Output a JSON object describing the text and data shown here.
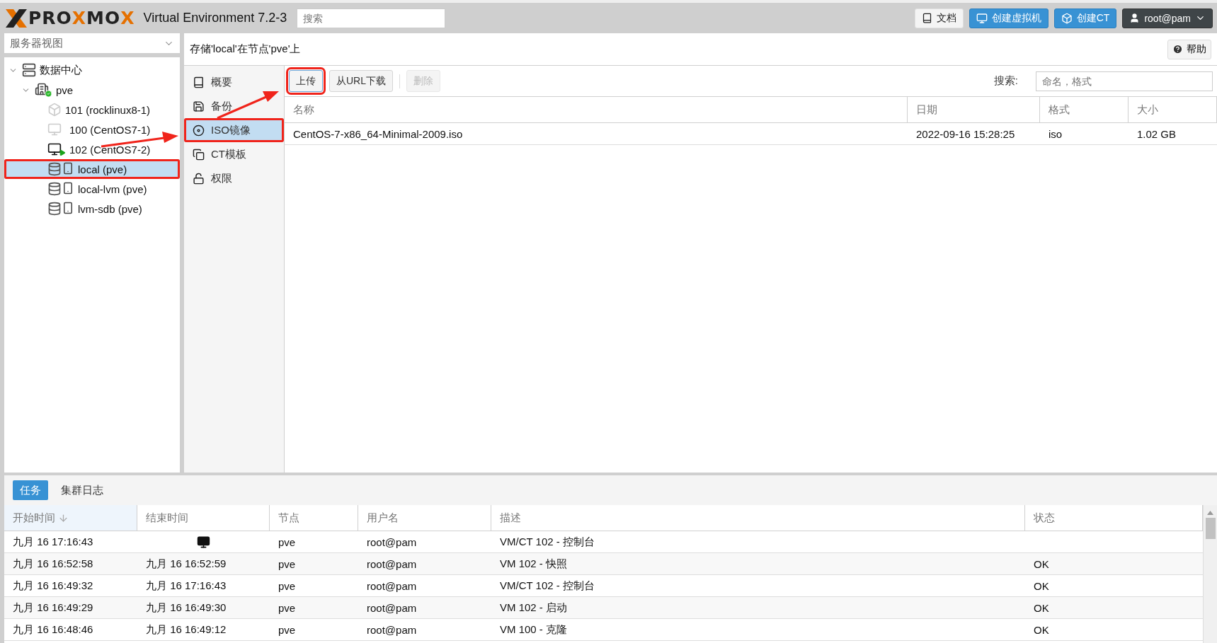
{
  "header": {
    "logo": [
      {
        "text": "PRO",
        "accent": false
      },
      {
        "text": "X",
        "accent": true
      },
      {
        "text": "MO",
        "accent": false
      },
      {
        "text": "X",
        "accent": true
      }
    ],
    "product": "Virtual Environment 7.2-3",
    "search_placeholder": "搜索",
    "buttons": [
      {
        "label": "文档",
        "kind": "docs"
      },
      {
        "label": "创建虚拟机",
        "kind": "vm"
      },
      {
        "label": "创建CT",
        "kind": "ct"
      }
    ],
    "user": "root@pam"
  },
  "sidebar": {
    "view": "服务器视图",
    "tree": [
      {
        "label": "数据中心",
        "kind": "datacenter",
        "expanded": true,
        "selected": false,
        "children": [
          {
            "label": "pve",
            "kind": "node",
            "expanded": true,
            "selected": false,
            "children": [
              {
                "label": "101 (rocklinux8-1)",
                "kind": "ct",
                "running": false,
                "selected": false
              },
              {
                "label": "100 (CentOS7-1)",
                "kind": "vm",
                "running": false,
                "selected": false
              },
              {
                "label": "102 (CentOS7-2)",
                "kind": "vm",
                "running": true,
                "selected": false
              },
              {
                "label": "local (pve)",
                "kind": "storage",
                "selected": true,
                "annotated": true
              },
              {
                "label": "local-lvm (pve)",
                "kind": "storage",
                "selected": false
              },
              {
                "label": "lvm-sdb (pve)",
                "kind": "storage",
                "selected": false
              }
            ]
          }
        ]
      }
    ]
  },
  "content": {
    "title": "存储'local'在节点'pve'上",
    "help": "帮助",
    "nav": [
      {
        "label": "概要",
        "kind": "summary",
        "selected": false
      },
      {
        "label": "备份",
        "kind": "backup",
        "selected": false
      },
      {
        "label": "ISO镜像",
        "kind": "iso",
        "selected": true,
        "annotated": true
      },
      {
        "label": "CT模板",
        "kind": "template",
        "selected": false
      },
      {
        "label": "权限",
        "kind": "permissions",
        "selected": false
      }
    ],
    "toolbar": {
      "buttons": [
        {
          "label": "上传",
          "disabled": false,
          "annotated": true
        },
        {
          "label": "从URL下载",
          "disabled": false,
          "annotated": false
        },
        {
          "label": "删除",
          "disabled": true,
          "annotated": false
        }
      ],
      "search_label": "搜索:",
      "search_placeholder": "命名，格式"
    },
    "table": {
      "columns": [
        "名称",
        "日期",
        "格式",
        "大小"
      ],
      "rows": [
        [
          "CentOS-7-x86_64-Minimal-2009.iso",
          "2022-09-16 15:28:25",
          "iso",
          "1.02 GB"
        ]
      ]
    }
  },
  "tasks": {
    "tabs": [
      {
        "label": "任务",
        "selected": true
      },
      {
        "label": "集群日志",
        "selected": false
      }
    ],
    "columns": [
      {
        "label": "开始时间",
        "sorted": true
      },
      {
        "label": "结束时间",
        "sorted": false
      },
      {
        "label": "节点",
        "sorted": false
      },
      {
        "label": "用户名",
        "sorted": false
      },
      {
        "label": "描述",
        "sorted": false
      },
      {
        "label": "状态",
        "sorted": false
      }
    ],
    "rows": [
      {
        "start": "九月 16 17:16:43",
        "running": true,
        "node": "pve",
        "user": "root@pam",
        "description": "VM/CT 102 - 控制台"
      },
      {
        "start": "九月 16 16:52:58",
        "end": "九月 16 16:52:59",
        "running": false,
        "node": "pve",
        "user": "root@pam",
        "description": "VM 102 - 快照",
        "status": "OK"
      },
      {
        "start": "九月 16 16:49:32",
        "end": "九月 16 17:16:43",
        "running": false,
        "node": "pve",
        "user": "root@pam",
        "description": "VM/CT 102 - 控制台",
        "status": "OK"
      },
      {
        "start": "九月 16 16:49:29",
        "end": "九月 16 16:49:30",
        "running": false,
        "node": "pve",
        "user": "root@pam",
        "description": "VM 102 - 启动",
        "status": "OK"
      },
      {
        "start": "九月 16 16:48:46",
        "end": "九月 16 16:49:12",
        "running": false,
        "node": "pve",
        "user": "root@pam",
        "description": "VM 100 - 克隆",
        "status": "OK"
      }
    ]
  },
  "annotations": {
    "arrows": true
  }
}
